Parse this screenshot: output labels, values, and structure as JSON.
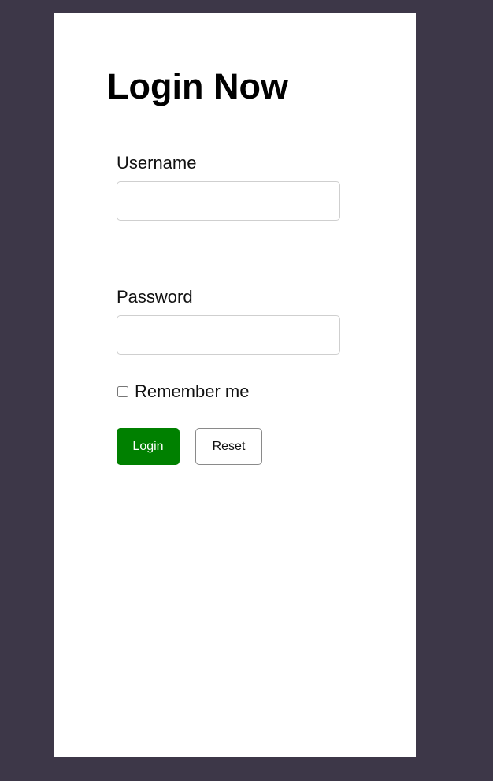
{
  "login_form": {
    "title": "Login Now",
    "username": {
      "label": "Username",
      "value": "",
      "placeholder": ""
    },
    "password": {
      "label": "Password",
      "value": "",
      "placeholder": ""
    },
    "remember_me": {
      "label": "Remember me",
      "checked": false
    },
    "buttons": {
      "login_label": "Login",
      "reset_label": "Reset"
    }
  },
  "colors": {
    "background": "#3d3748",
    "card": "#ffffff",
    "login_button": "#008000"
  }
}
